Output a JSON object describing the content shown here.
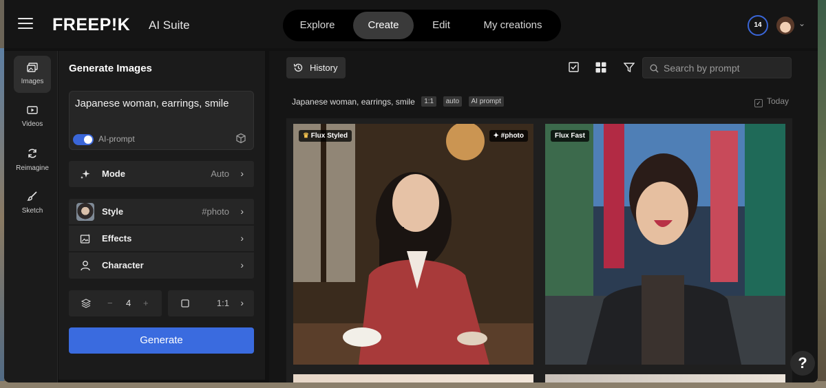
{
  "header": {
    "logo": "FREEP!K",
    "suite": "AI Suite",
    "nav": [
      {
        "label": "Explore",
        "active": false
      },
      {
        "label": "Create",
        "active": true
      },
      {
        "label": "Edit",
        "active": false
      },
      {
        "label": "My creations",
        "active": false
      }
    ],
    "credits": "14"
  },
  "rail": [
    {
      "label": "Images",
      "icon": "images-icon",
      "active": true
    },
    {
      "label": "Videos",
      "icon": "video-icon",
      "active": false
    },
    {
      "label": "Reimagine",
      "icon": "reimagine-icon",
      "active": false
    },
    {
      "label": "Sketch",
      "icon": "brush-icon",
      "active": false
    }
  ],
  "panel": {
    "title": "Generate Images",
    "prompt": "Japanese woman, earrings, smile",
    "ai_prompt_label": "AI-prompt",
    "ai_prompt_on": true,
    "mode": {
      "label": "Mode",
      "value": "Auto"
    },
    "style": {
      "label": "Style",
      "value": "#photo"
    },
    "effects": {
      "label": "Effects"
    },
    "character": {
      "label": "Character"
    },
    "count": {
      "minus": "−",
      "value": "4",
      "plus": "+"
    },
    "ratio": "1:1",
    "generate_label": "Generate"
  },
  "toolbar": {
    "history_label": "History",
    "search_placeholder": "Search by prompt"
  },
  "results": {
    "prompt": "Japanese woman, earrings, smile",
    "chips": [
      "1:1",
      "auto",
      "AI prompt"
    ],
    "today_label": "Today",
    "images": [
      {
        "badge_left": "Flux Styled",
        "badge_right": "#photo"
      },
      {
        "badge_left": "Flux Fast"
      }
    ]
  },
  "help_label": "?",
  "colors": {
    "accent": "#3a6bdf",
    "credits_ring": "#3a66d8"
  }
}
